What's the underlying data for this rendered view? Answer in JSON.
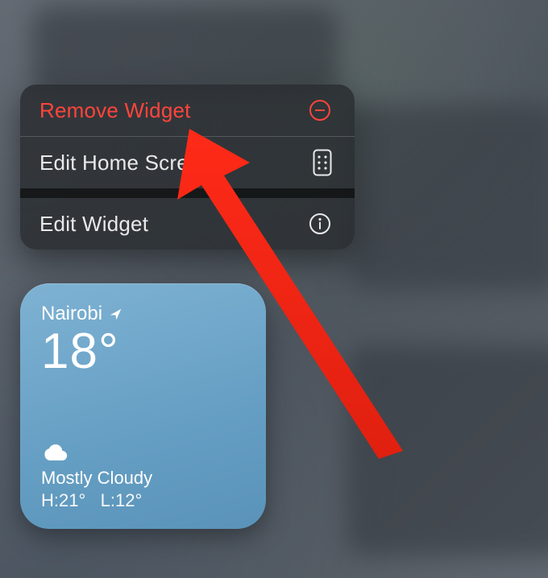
{
  "colors": {
    "destructive": "#ff453a",
    "widget_bg_top": "#7eb2d3",
    "widget_bg_bottom": "#5a93b9"
  },
  "menu": {
    "items": [
      {
        "label": "Remove Widget",
        "icon": "minus-circle-icon",
        "destructive": true
      },
      {
        "label": "Edit Home Screen",
        "icon": "apps-grid-icon",
        "destructive": false
      },
      {
        "label": "Edit Widget",
        "icon": "info-circle-icon",
        "destructive": false
      }
    ]
  },
  "weather_widget": {
    "location": "Nairobi",
    "temperature": "18°",
    "condition": "Mostly Cloudy",
    "high_label": "H:",
    "high": "21°",
    "low_label": "L:",
    "low": "12°"
  }
}
